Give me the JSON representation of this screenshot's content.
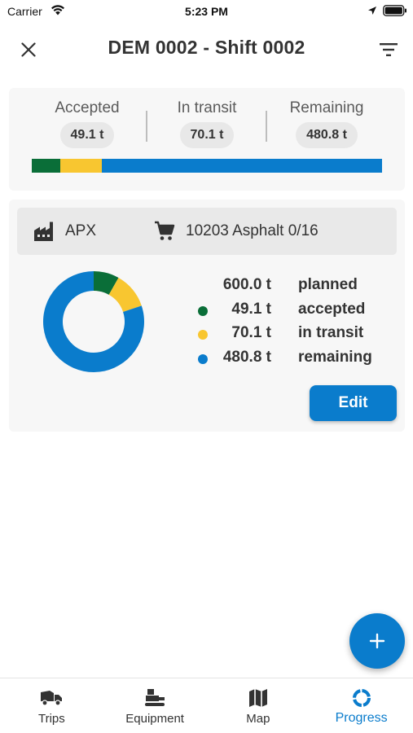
{
  "status_bar": {
    "carrier": "Carrier",
    "time": "5:23 PM"
  },
  "header": {
    "title": "DEM 0002 - Shift 0002"
  },
  "summary": {
    "stats": [
      {
        "label": "Accepted",
        "value": "49.1 t"
      },
      {
        "label": "In transit",
        "value": "70.1 t"
      },
      {
        "label": "Remaining",
        "value": "480.8 t"
      }
    ],
    "progress_fractions": {
      "accepted": 0.082,
      "in_transit": 0.117,
      "remaining": 0.801
    }
  },
  "detail": {
    "plant": "APX",
    "material": "10203 Asphalt 0/16",
    "legend": [
      {
        "value": "600.0 t",
        "text": "planned",
        "color": ""
      },
      {
        "value": "49.1 t",
        "text": "accepted",
        "color": "#0a6e38"
      },
      {
        "value": "70.1 t",
        "text": "in transit",
        "color": "#f8c630"
      },
      {
        "value": "480.8 t",
        "text": "remaining",
        "color": "#0a7ccc"
      }
    ],
    "donut": {
      "accepted": 49.1,
      "in_transit": 70.1,
      "remaining": 480.8
    },
    "edit_label": "Edit"
  },
  "colors": {
    "accent": "#0a7ccc",
    "accepted": "#0a6e38",
    "in_transit": "#f8c630",
    "remaining": "#0a7ccc"
  },
  "fab": {
    "icon": "plus-icon"
  },
  "tabs": [
    {
      "label": "Trips",
      "icon": "truck-icon"
    },
    {
      "label": "Equipment",
      "icon": "paver-icon"
    },
    {
      "label": "Map",
      "icon": "map-icon"
    },
    {
      "label": "Progress",
      "icon": "progress-ring-icon",
      "active": true
    }
  ]
}
